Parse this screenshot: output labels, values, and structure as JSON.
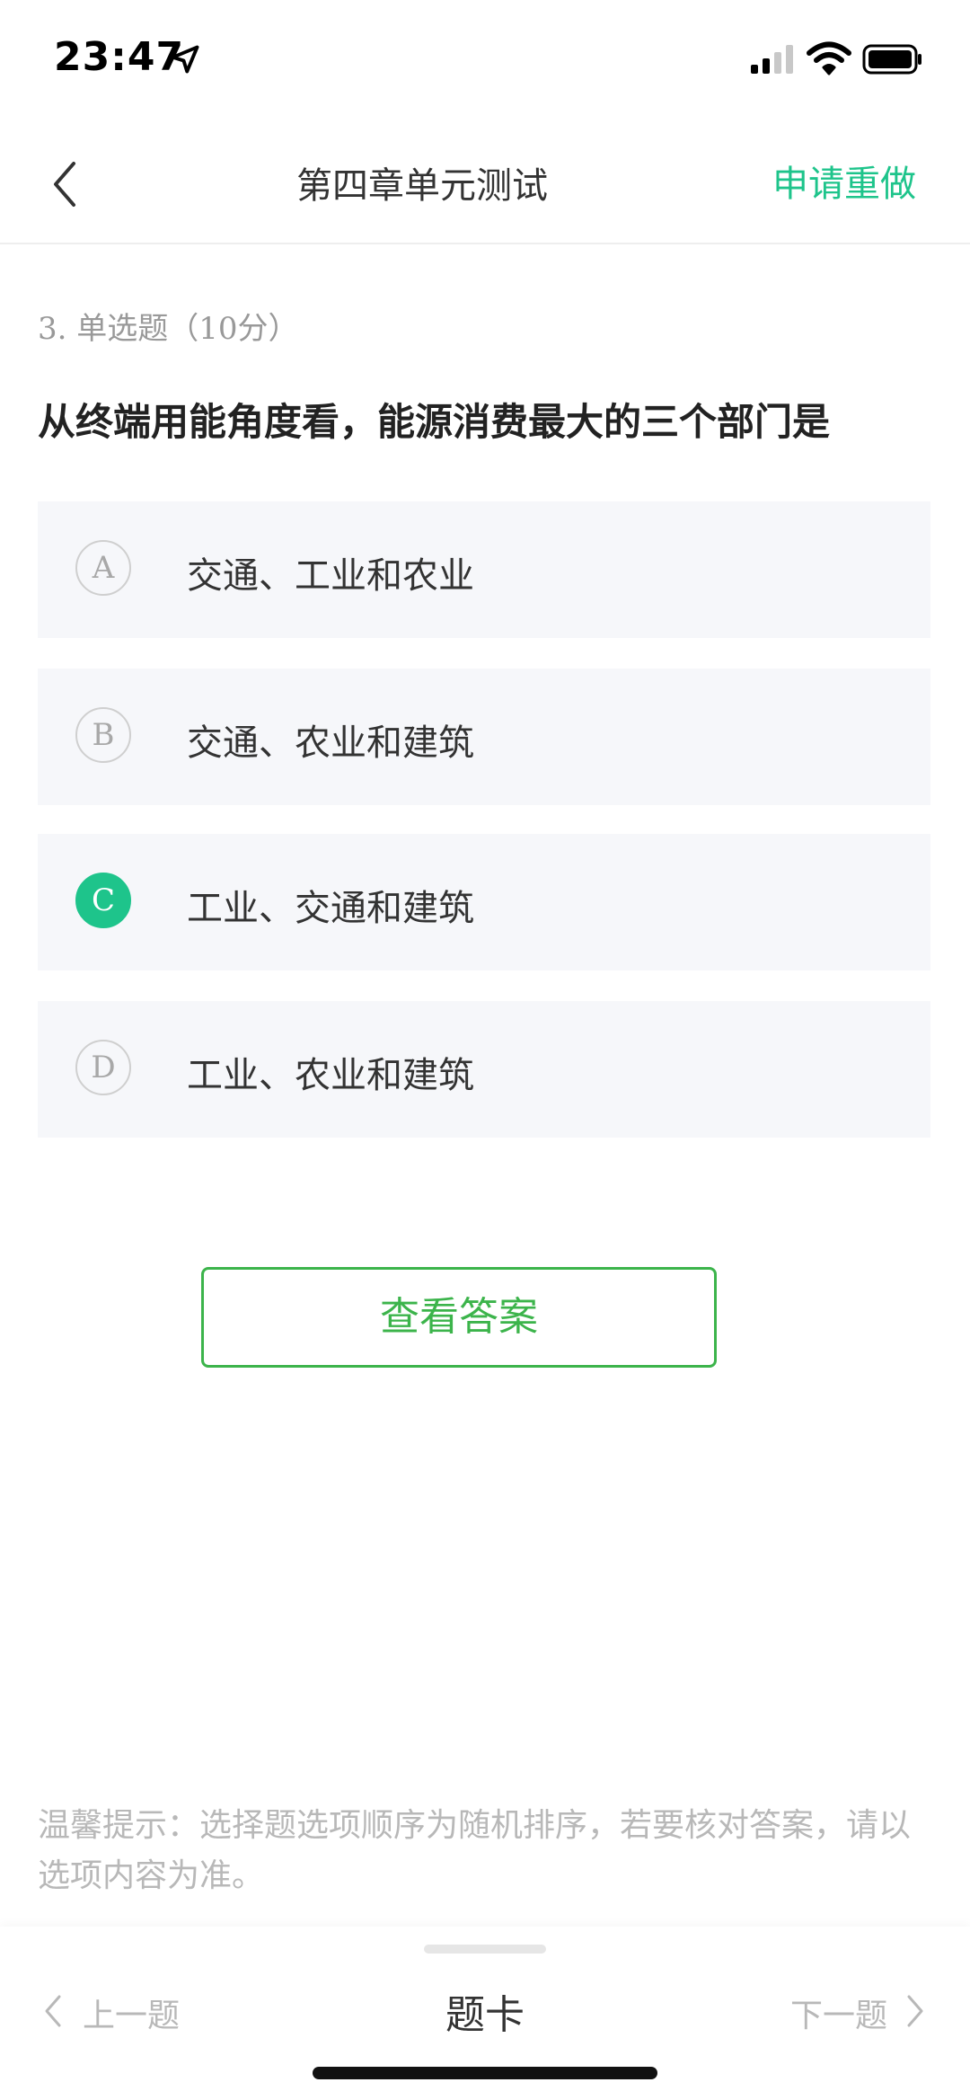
{
  "status_bar": {
    "time": "23:47"
  },
  "nav": {
    "title": "第四章单元测试",
    "redo_label": "申请重做"
  },
  "question": {
    "type_label": "3. 单选题（10分）",
    "text": "从终端用能角度看，能源消费最大的三个部门是",
    "selected": "C",
    "options": [
      {
        "letter": "A",
        "text": "交通、工业和农业"
      },
      {
        "letter": "B",
        "text": "交通、农业和建筑"
      },
      {
        "letter": "C",
        "text": "工业、交通和建筑"
      },
      {
        "letter": "D",
        "text": "工业、农业和建筑"
      }
    ]
  },
  "answer_button_label": "查看答案",
  "tip": "温馨提示：选择题选项顺序为随机排序，若要核对答案，请以选项内容为准。",
  "bottom_bar": {
    "prev_label": "上一题",
    "card_label": "题卡",
    "next_label": "下一题"
  },
  "colors": {
    "accent": "#1ec48b",
    "button_green": "#3cb44b",
    "option_bg": "#f6f7fa",
    "muted_text": "#b8b8b8"
  },
  "icons": {
    "location": "location-arrow-icon",
    "signal": "cellular-signal-icon",
    "wifi": "wifi-icon",
    "battery": "battery-icon",
    "back": "chevron-left-icon",
    "prev": "chevron-left-icon",
    "next": "chevron-right-icon"
  }
}
